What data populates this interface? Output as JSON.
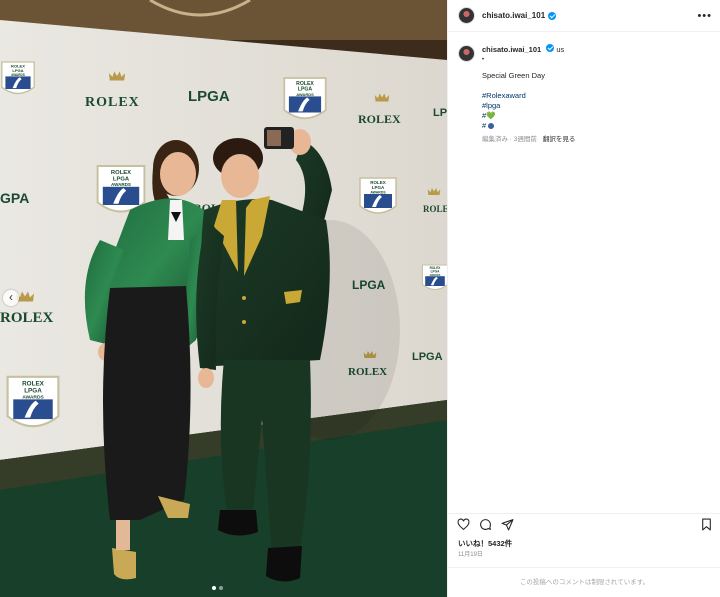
{
  "post": {
    "username": "chisato.iwai_101",
    "location_suffix": "us",
    "caption_dot": "•",
    "caption_text": "Special Green Day",
    "hashtags": [
      "#Rolexaward",
      "#lpga",
      "#"
    ],
    "hashtag_emoji": "💚",
    "last_line": "#",
    "edited_label": "編集済み · 3週間前",
    "translate_label": "翻訳を見る",
    "likes": "いいね！5432件",
    "date": "11月19日",
    "comments_restricted": "この投稿へのコメントは制限されています。",
    "more_menu": "•••"
  },
  "photo": {
    "backdrop_words": {
      "rolex": "ROLEX",
      "lpga": "LPGA",
      "awards_line1": "ROLEX",
      "awards_line2": "LPGA",
      "awards_line3": "AWARDS"
    },
    "carousel_prev": "‹",
    "slide_count": 2,
    "active_slide": 1
  },
  "icons": {
    "like": "heart-icon",
    "comment": "comment-icon",
    "share": "share-icon",
    "save": "bookmark-icon",
    "verified": "verified-badge-icon"
  },
  "colors": {
    "verified_blue": "#0095f6",
    "link_blue": "#00376b",
    "muted_gray": "#8e8e8e"
  }
}
